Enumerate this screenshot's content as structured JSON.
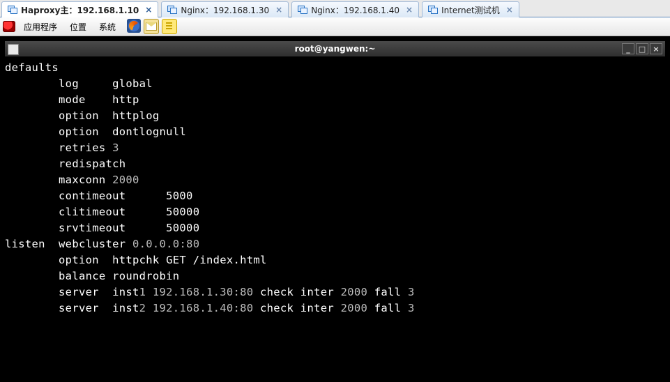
{
  "tabs": [
    {
      "label": "Haproxy主：192.168.1.10",
      "active": true
    },
    {
      "label": "Nginx：192.168.1.30",
      "active": false
    },
    {
      "label": "Nginx：192.168.1.40",
      "active": false
    },
    {
      "label": "Internet测试机",
      "active": false
    }
  ],
  "menubar": {
    "apps": "应用程序",
    "places": "位置",
    "system": "系统"
  },
  "terminal_title": "root@yangwen:~",
  "config": {
    "defaults_keyword": "defaults",
    "log": "        log     global",
    "mode": "        mode    http",
    "opt1": "        option  httplog",
    "opt2": "        option  dontlognull",
    "retries": "        retries 3",
    "redispatch": "        redispatch",
    "maxconn": "        maxconn 2000",
    "cont": "        contimeout      5000",
    "clit": "        clitimeout      50000",
    "srvt": "        srvtimeout      50000",
    "blank": "",
    "listen_hdr_a": "listen  webcluster ",
    "listen_hdr_b": "0.0.0.0:80",
    "httpchk": "        option  httpchk GET /index.html",
    "balance": "        balance roundrobin",
    "srv1a": "        server  inst",
    "srv1b": "1 192.168.1.30:80 ",
    "srv1c": "check inter ",
    "srv1d": "2000 ",
    "srv1e": "fall ",
    "srv1f": "3",
    "srv2a": "        server  inst",
    "srv2b": "2 192.168.1.40:80 ",
    "srv2c": "check inter ",
    "srv2d": "2000 ",
    "srv2e": "fall ",
    "srv2f": "3"
  },
  "winbtn": {
    "min": "_",
    "max": "□",
    "close": "×"
  }
}
